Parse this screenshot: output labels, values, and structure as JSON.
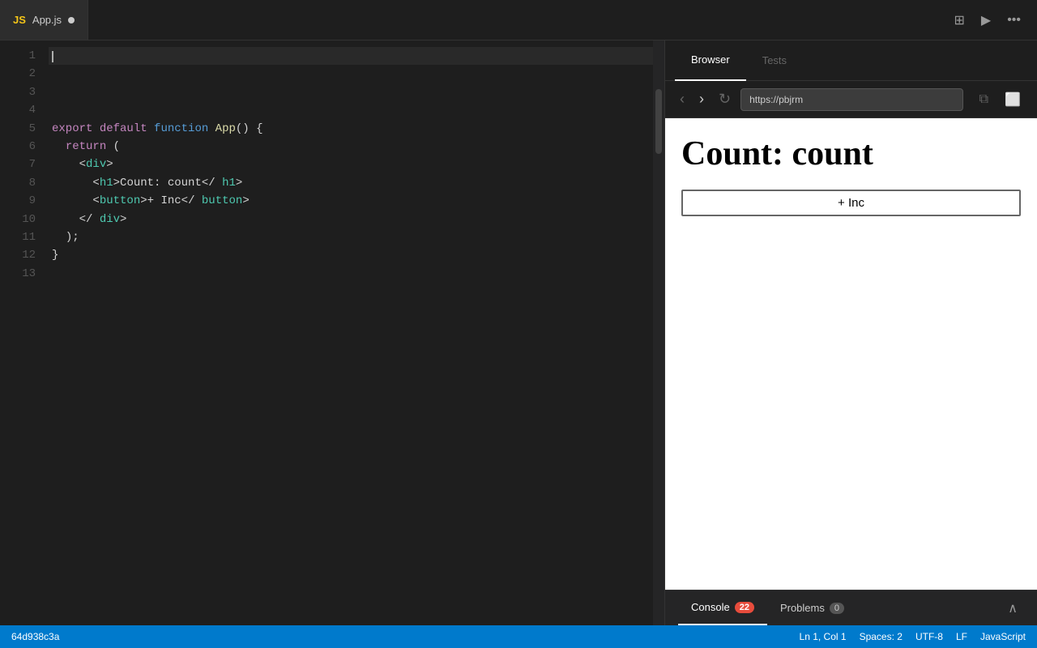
{
  "tab": {
    "js_label": "JS",
    "filename": "App.js",
    "modified_dot": true
  },
  "editor": {
    "lines": [
      {
        "num": "1",
        "content": "",
        "cursor": true
      },
      {
        "num": "2",
        "content": ""
      },
      {
        "num": "3",
        "content": ""
      },
      {
        "num": "4",
        "content": ""
      },
      {
        "num": "5",
        "content": "export default function App() {"
      },
      {
        "num": "6",
        "content": "  return ("
      },
      {
        "num": "7",
        "content": "    <div>"
      },
      {
        "num": "8",
        "content": "      <h1>Count: count</ h1>"
      },
      {
        "num": "9",
        "content": "      <button>+ Inc</ button>"
      },
      {
        "num": "10",
        "content": "    </ div>"
      },
      {
        "num": "11",
        "content": "  );"
      },
      {
        "num": "12",
        "content": "}"
      },
      {
        "num": "13",
        "content": ""
      }
    ]
  },
  "browser": {
    "tab_browser": "Browser",
    "tab_tests": "Tests",
    "url": "https://pbjrm",
    "heading": "Count: count",
    "button_label": "+ Inc"
  },
  "console_bar": {
    "console_label": "Console",
    "console_count": "22",
    "problems_label": "Problems",
    "problems_count": "0"
  },
  "status_bar": {
    "hash": "64d938c3a",
    "position": "Ln 1, Col 1",
    "spaces": "Spaces: 2",
    "encoding": "UTF-8",
    "eol": "LF",
    "language": "JavaScript"
  },
  "toolbar": {
    "layout_icon": "⊞",
    "play_icon": "▶",
    "more_icon": "•••"
  },
  "nav": {
    "back": "‹",
    "forward": "›",
    "reload": "↻",
    "copy_url": "⧉",
    "open_external": "⬜"
  }
}
